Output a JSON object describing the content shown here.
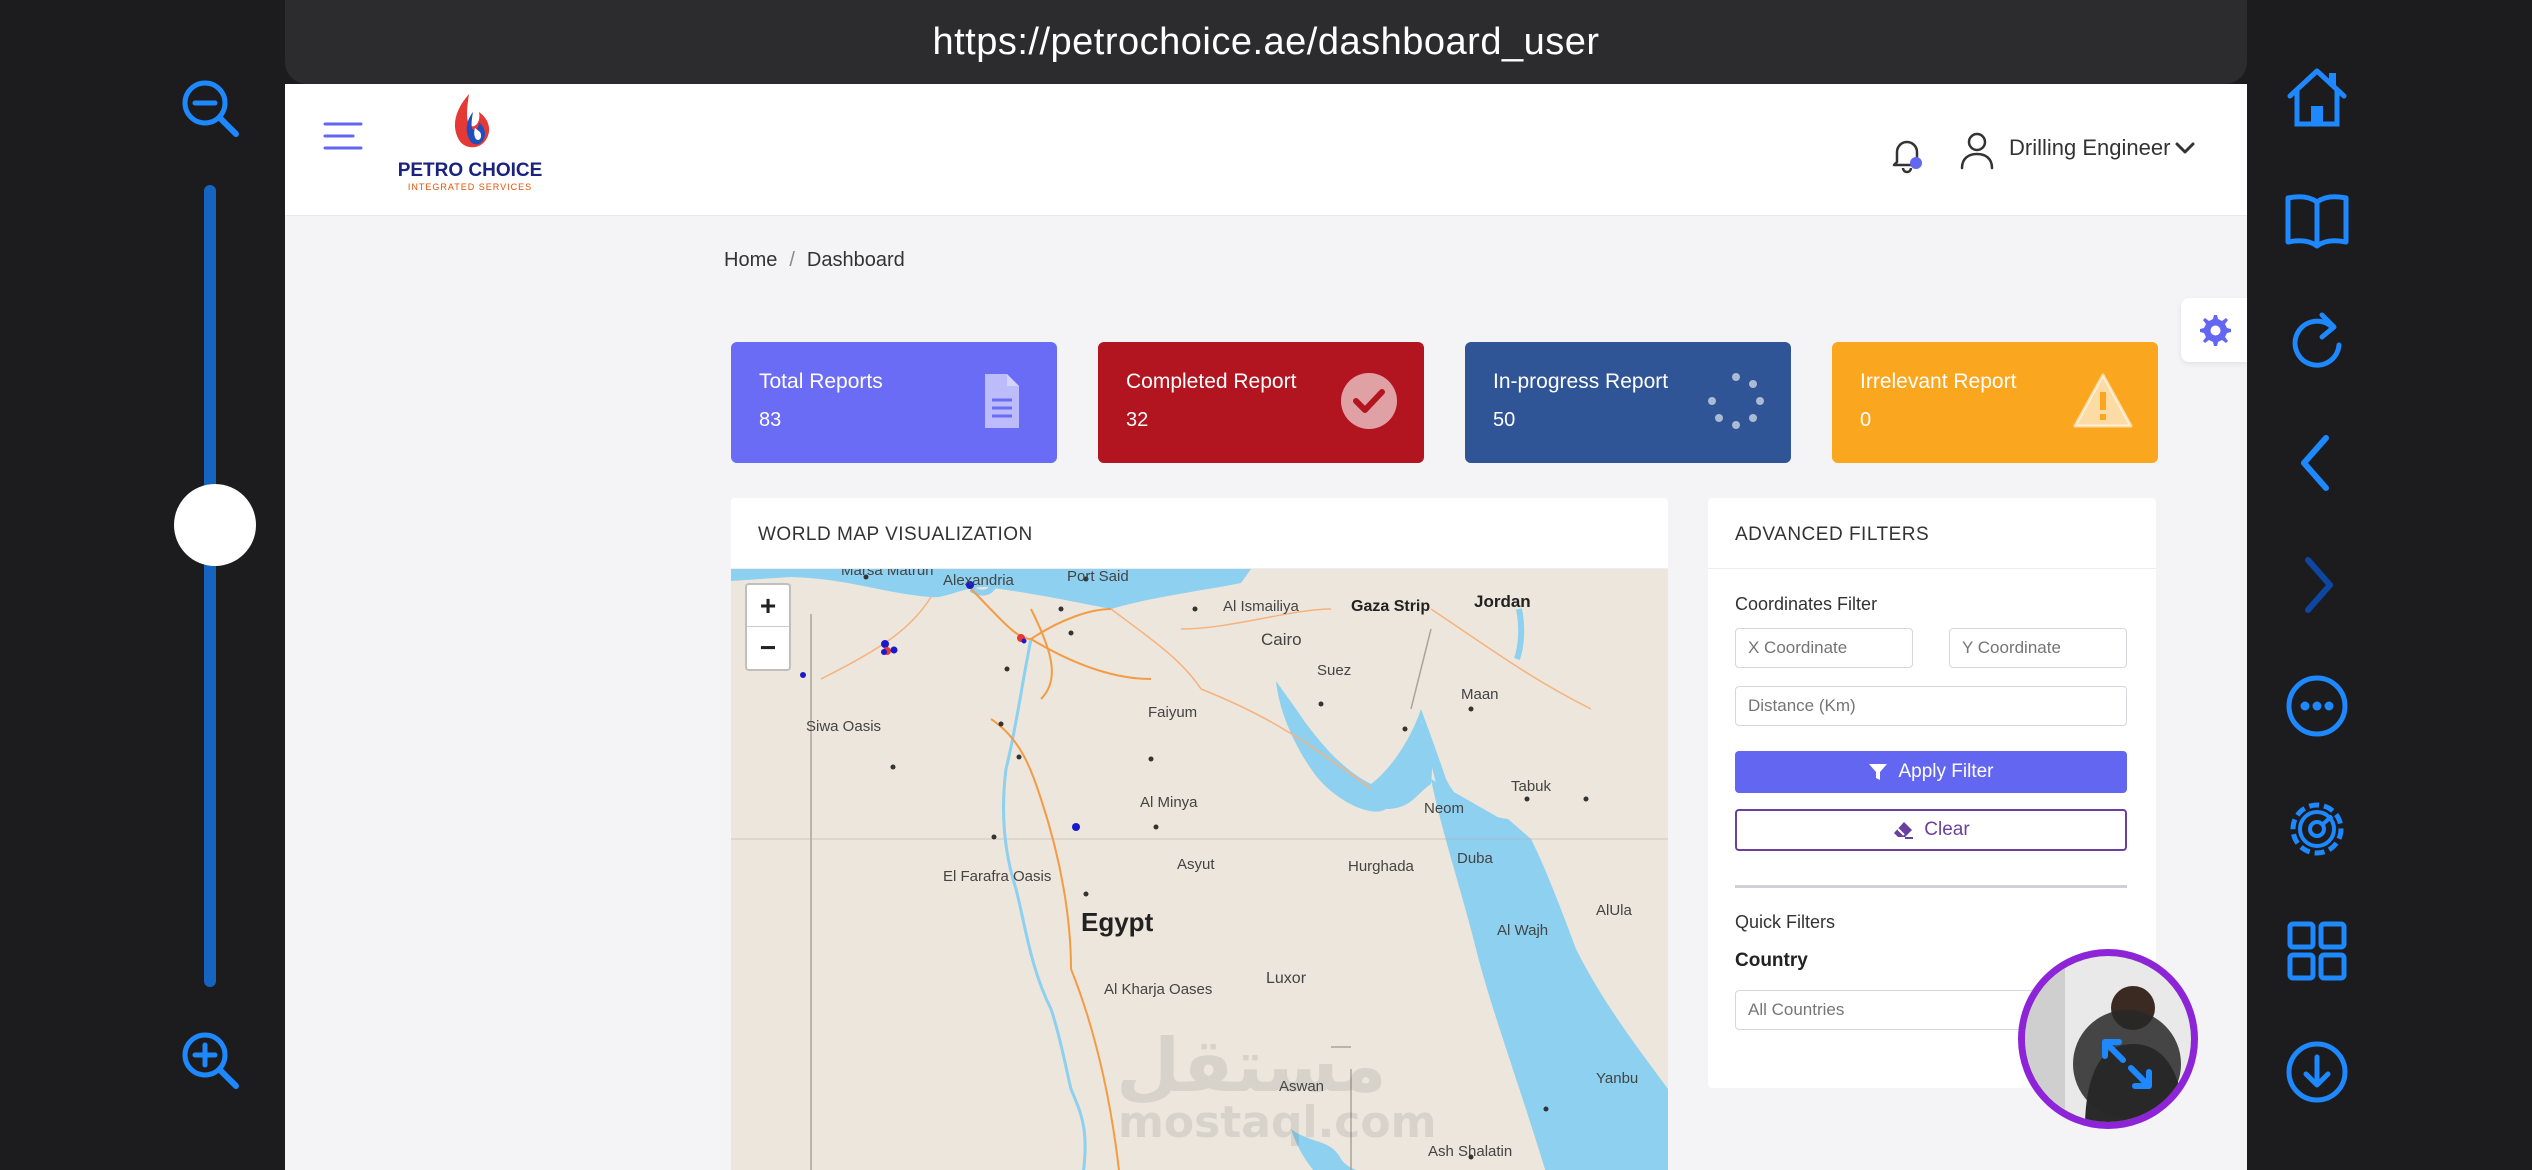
{
  "browser": {
    "url": "https://petrochoice.ae/dashboard_user"
  },
  "header": {
    "logo_title": "PETRO CHOICE",
    "logo_subtitle": "INTEGRATED SERVICES",
    "user_name": "Drilling Engineer"
  },
  "breadcrumb": {
    "home": "Home",
    "separator": "/",
    "current": "Dashboard"
  },
  "cards": [
    {
      "title": "Total Reports",
      "value": "83",
      "color": "#6366f1",
      "icon": "file-icon"
    },
    {
      "title": "Completed Report",
      "value": "32",
      "color": "#b71c1c",
      "icon": "check-circle-icon"
    },
    {
      "title": "In-progress Report",
      "value": "50",
      "color": "#2f5596",
      "icon": "spinner-icon"
    },
    {
      "title": "Irrelevant Report",
      "value": "0",
      "color": "#ffa726",
      "icon": "warning-icon"
    }
  ],
  "map_panel": {
    "title": "WORLD MAP VISUALIZATION",
    "zoom_in": "+",
    "zoom_out": "−",
    "labels": [
      {
        "text": "Marsa Matruh"
      },
      {
        "text": "Alexandria"
      },
      {
        "text": "Port Said"
      },
      {
        "text": "Gaza Strip"
      },
      {
        "text": "Jordan"
      },
      {
        "text": "Al Ismailiya"
      },
      {
        "text": "Cairo"
      },
      {
        "text": "Suez"
      },
      {
        "text": "Maan"
      },
      {
        "text": "Siwa Oasis"
      },
      {
        "text": "Faiyum"
      },
      {
        "text": "Tabuk"
      },
      {
        "text": "Al Minya"
      },
      {
        "text": "Neom"
      },
      {
        "text": "El Farafra Oasis"
      },
      {
        "text": "Asyut"
      },
      {
        "text": "Hurghada"
      },
      {
        "text": "Duba"
      },
      {
        "text": "Egypt"
      },
      {
        "text": "Al Wajh"
      },
      {
        "text": "AlUla"
      },
      {
        "text": "Al Kharja Oases"
      },
      {
        "text": "Luxor"
      },
      {
        "text": "Aswan"
      },
      {
        "text": "Yanbu"
      },
      {
        "text": "Ash Shalatin"
      }
    ]
  },
  "filters": {
    "title": "ADVANCED FILTERS",
    "coords_label": "Coordinates Filter",
    "x_placeholder": "X Coordinate",
    "y_placeholder": "Y Coordinate",
    "distance_placeholder": "Distance (Km)",
    "apply_label": "Apply Filter",
    "clear_label": "Clear",
    "quick_label": "Quick Filters",
    "country_label": "Country",
    "country_value": "All Countries"
  },
  "sidebar_controls": {
    "left": [
      "zoom-out-icon",
      "zoom-in-icon"
    ],
    "right": [
      "home-icon",
      "book-icon",
      "reload-icon",
      "back-icon",
      "forward-icon",
      "more-icon",
      "settings-icon",
      "grid-icon",
      "download-icon"
    ]
  },
  "watermark": {
    "arabic": "مستقل",
    "latin": "mostaql.com"
  }
}
